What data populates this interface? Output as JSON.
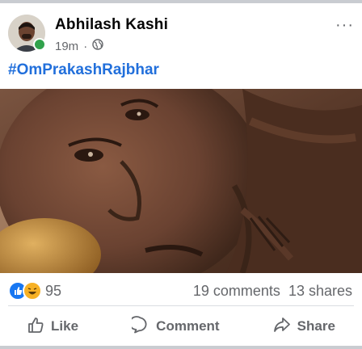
{
  "post": {
    "author": "Abhilash Kashi",
    "time": "19m",
    "separator": "·",
    "privacy_icon": "globe-icon",
    "more_label": "···",
    "hashtag": "#OmPrakashRajbhar",
    "reaction_icons": [
      "like-reaction-icon",
      "haha-reaction-icon"
    ],
    "reaction_count": "95",
    "comments": "19 comments",
    "shares": "13 shares",
    "actions": {
      "like": "Like",
      "comment": "Comment",
      "share": "Share"
    }
  },
  "colors": {
    "hashtag": "#216fdb",
    "online": "#31a24c",
    "like_blue": "#1877f2",
    "muted_text": "#65676b"
  }
}
